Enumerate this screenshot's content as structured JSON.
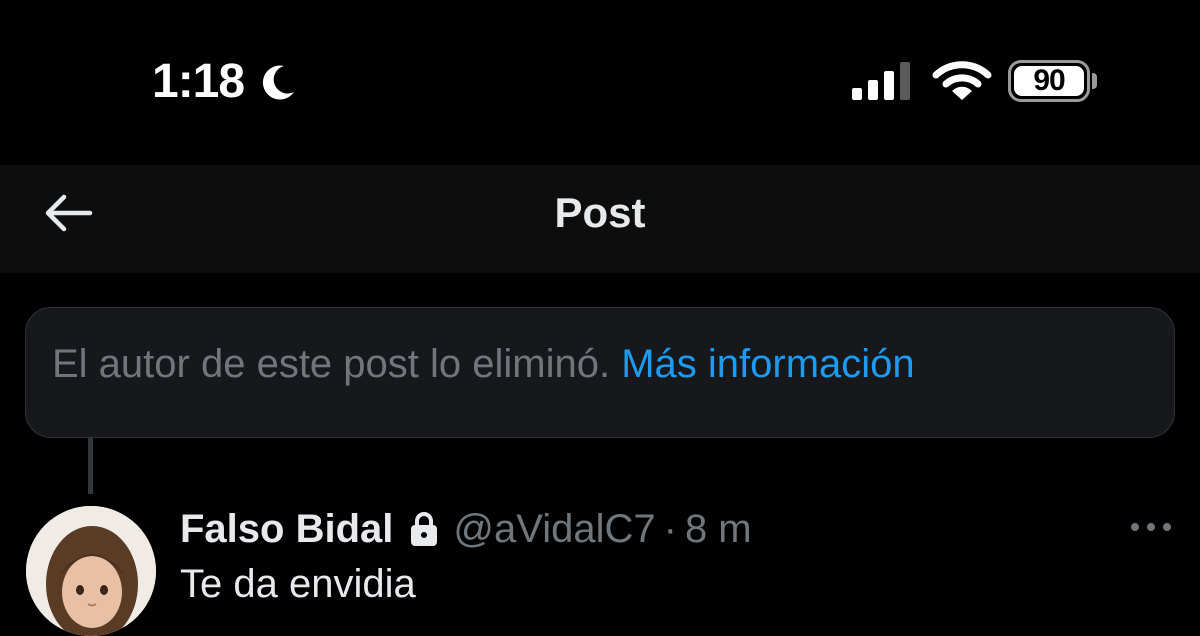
{
  "status_bar": {
    "time": "1:18",
    "moon_icon": "moon-icon",
    "signal_icon": "cellular-signal-icon",
    "wifi_icon": "wifi-icon",
    "battery_level": "90"
  },
  "header": {
    "back_icon": "arrow-left-icon",
    "title": "Post"
  },
  "deleted_notice": {
    "text": "El autor de este post lo eliminó.",
    "link_label": "Más información"
  },
  "post": {
    "display_name": "Falso Bidal",
    "lock_icon": "lock-icon",
    "handle": "@aVidalC7",
    "separator": "·",
    "time": "8 m",
    "more_icon": "more-horizontal-icon",
    "text": "Te da envidia"
  },
  "colors": {
    "background": "#000000",
    "header_background": "#0d0d0d",
    "notice_background": "#16181c",
    "primary_text": "#e7e9ea",
    "secondary_text": "#71767b",
    "link": "#1d9bf0"
  }
}
